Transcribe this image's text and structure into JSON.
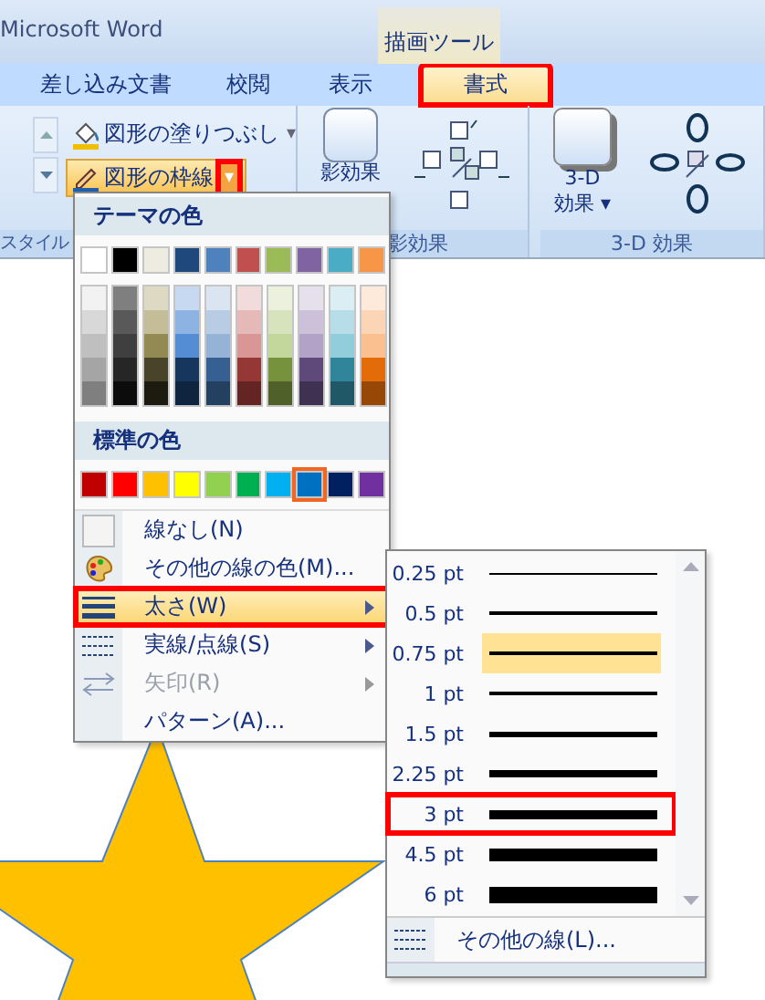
{
  "window": {
    "title": "Microsoft Word"
  },
  "contextual_tab": {
    "label": "描画ツール"
  },
  "tabs": [
    {
      "label": "差し込み文書",
      "selected": false,
      "marked": false
    },
    {
      "label": "校閲",
      "selected": false,
      "marked": false
    },
    {
      "label": "表示",
      "selected": false,
      "marked": false
    },
    {
      "label": "書式",
      "selected": true,
      "marked": true
    }
  ],
  "ribbon": {
    "fill_button": {
      "label": "図形の塗りつぶし",
      "arrow": "▾"
    },
    "outline_button": {
      "label": "図形の枠線",
      "arrow": "▾",
      "active": true,
      "marked": true
    },
    "style_group_label": "スタイル",
    "shadow_button": {
      "label": "影効果"
    },
    "shadow_group_label": "影効果",
    "threed_button": {
      "label": "3-D",
      "label2": "効果",
      "arrow": "▾"
    },
    "threed_group_label": "3-D 効果"
  },
  "color_menu": {
    "theme_header": "テーマの色",
    "theme_colors": [
      {
        "color": "#ffffff",
        "shades": [
          {
            "color": "#f2f2f2"
          },
          {
            "color": "#d8d8d8"
          },
          {
            "color": "#bfbfbf"
          },
          {
            "color": "#a5a5a5"
          },
          {
            "color": "#7f7f7f"
          }
        ]
      },
      {
        "color": "#000000",
        "shades": [
          {
            "color": "#7f7f7f"
          },
          {
            "color": "#595959"
          },
          {
            "color": "#3f3f3f"
          },
          {
            "color": "#262626"
          },
          {
            "color": "#0c0c0c"
          }
        ]
      },
      {
        "color": "#eeece1",
        "shades": [
          {
            "color": "#ddd9c3"
          },
          {
            "color": "#c4bd97"
          },
          {
            "color": "#938953"
          },
          {
            "color": "#494429"
          },
          {
            "color": "#1d1b10"
          }
        ]
      },
      {
        "color": "#1f497d",
        "shades": [
          {
            "color": "#c6d9f0"
          },
          {
            "color": "#8db3e2"
          },
          {
            "color": "#548dd4"
          },
          {
            "color": "#17365d"
          },
          {
            "color": "#0f243e"
          }
        ]
      },
      {
        "color": "#4f81bd",
        "shades": [
          {
            "color": "#dbe5f1"
          },
          {
            "color": "#b8cce4"
          },
          {
            "color": "#95b3d7"
          },
          {
            "color": "#366092"
          },
          {
            "color": "#244061"
          }
        ]
      },
      {
        "color": "#c0504d",
        "shades": [
          {
            "color": "#f2dcdb"
          },
          {
            "color": "#e5b9b7"
          },
          {
            "color": "#d99694"
          },
          {
            "color": "#953734"
          },
          {
            "color": "#632423"
          }
        ]
      },
      {
        "color": "#9bbb59",
        "shades": [
          {
            "color": "#ebf1dd"
          },
          {
            "color": "#d7e3bc"
          },
          {
            "color": "#c3d69b"
          },
          {
            "color": "#76923c"
          },
          {
            "color": "#4f6128"
          }
        ]
      },
      {
        "color": "#8064a2",
        "shades": [
          {
            "color": "#e5e0ec"
          },
          {
            "color": "#ccc1d9"
          },
          {
            "color": "#b2a2c7"
          },
          {
            "color": "#5f497a"
          },
          {
            "color": "#3f3151"
          }
        ]
      },
      {
        "color": "#4bacc6",
        "shades": [
          {
            "color": "#dbeef3"
          },
          {
            "color": "#b7dde8"
          },
          {
            "color": "#92cddc"
          },
          {
            "color": "#31859b"
          },
          {
            "color": "#205867"
          }
        ]
      },
      {
        "color": "#f79646",
        "shades": [
          {
            "color": "#fdeada"
          },
          {
            "color": "#fbd5b5"
          },
          {
            "color": "#fac08f"
          },
          {
            "color": "#e36c09"
          },
          {
            "color": "#974806"
          }
        ]
      }
    ],
    "standard_header": "標準の色",
    "standard_colors": [
      {
        "color": "#c00000",
        "selected": false
      },
      {
        "color": "#ff0000",
        "selected": false
      },
      {
        "color": "#ffc000",
        "selected": false
      },
      {
        "color": "#ffff00",
        "selected": false
      },
      {
        "color": "#92d050",
        "selected": false
      },
      {
        "color": "#00b050",
        "selected": false
      },
      {
        "color": "#00b0f0",
        "selected": false
      },
      {
        "color": "#0070c0",
        "selected": true
      },
      {
        "color": "#002060",
        "selected": false
      },
      {
        "color": "#7030a0",
        "selected": false
      }
    ],
    "items": [
      {
        "kind": "none",
        "label": "線なし(N)",
        "submenu": false,
        "disabled": false,
        "selected": false,
        "marked": false
      },
      {
        "kind": "palette",
        "label": "その他の線の色(M)...",
        "submenu": false,
        "disabled": false,
        "selected": false,
        "marked": false
      },
      {
        "kind": "weight",
        "label": "太さ(W)",
        "submenu": true,
        "disabled": false,
        "selected": true,
        "marked": true
      },
      {
        "kind": "dash",
        "label": "実線/点線(S)",
        "submenu": true,
        "disabled": false,
        "selected": false,
        "marked": false
      },
      {
        "kind": "arrow",
        "label": "矢印(R)",
        "submenu": true,
        "disabled": true,
        "selected": false,
        "marked": false
      },
      {
        "kind": "pattern",
        "label": "パターン(A)...",
        "submenu": false,
        "disabled": false,
        "selected": false,
        "marked": false
      }
    ]
  },
  "weight_menu": {
    "items": [
      {
        "label": "0.25 pt",
        "selected": false,
        "marked": false
      },
      {
        "label": "0.5 pt",
        "selected": false,
        "marked": false
      },
      {
        "label": "0.75 pt",
        "selected": true,
        "marked": false
      },
      {
        "label": "1 pt",
        "selected": false,
        "marked": false
      },
      {
        "label": "1.5 pt",
        "selected": false,
        "marked": false
      },
      {
        "label": "2.25 pt",
        "selected": false,
        "marked": false
      },
      {
        "label": "3 pt",
        "selected": false,
        "marked": true
      },
      {
        "label": "4.5 pt",
        "selected": false,
        "marked": false
      },
      {
        "label": "6 pt",
        "selected": false,
        "marked": false
      }
    ],
    "more": "その他の線(L)..."
  }
}
